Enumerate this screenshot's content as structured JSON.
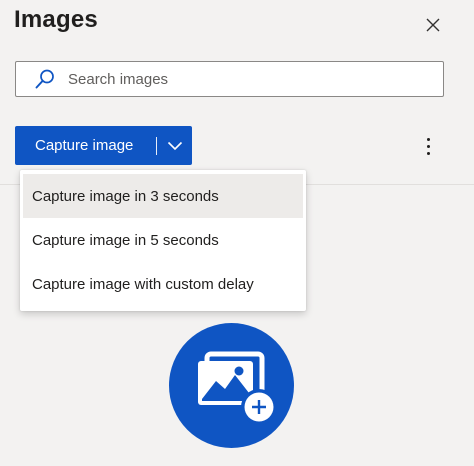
{
  "panel": {
    "title": "Images",
    "close_icon": "close-icon"
  },
  "search": {
    "placeholder": "Search images",
    "value": "",
    "icon": "search-icon"
  },
  "toolbar": {
    "capture_label": "Capture image",
    "dropdown_icon": "chevron-down-icon",
    "more_icon": "more-vertical-icon"
  },
  "capture_menu": {
    "items": [
      {
        "label": "Capture image in 3 seconds"
      },
      {
        "label": "Capture image in 5 seconds"
      },
      {
        "label": "Capture image with custom delay"
      }
    ]
  },
  "empty_state": {
    "icon": "add-image-icon"
  },
  "colors": {
    "accent": "#0f55c3",
    "panel_bg": "#f3f2f1",
    "hover_bg": "#edebe9",
    "text": "#201f1e"
  }
}
